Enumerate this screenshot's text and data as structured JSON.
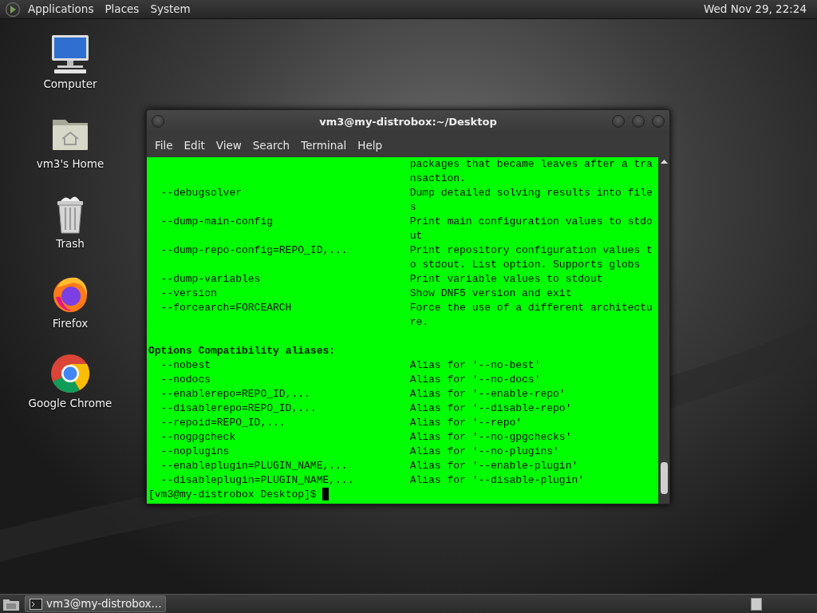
{
  "top_panel": {
    "menus": [
      "Applications",
      "Places",
      "System"
    ],
    "clock": "Wed Nov 29, 22:24"
  },
  "desktop_icons": [
    {
      "kind": "computer",
      "label": "Computer"
    },
    {
      "kind": "home",
      "label": "vm3's Home"
    },
    {
      "kind": "trash",
      "label": "Trash"
    },
    {
      "kind": "firefox",
      "label": "Firefox"
    },
    {
      "kind": "chrome",
      "label": "Google Chrome"
    }
  ],
  "terminal": {
    "title": "vm3@my-distrobox:~/Desktop",
    "menu": [
      "File",
      "Edit",
      "View",
      "Search",
      "Terminal",
      "Help"
    ],
    "lines": [
      {
        "kind": "row",
        "description": "packages that became leaves after a tra"
      },
      {
        "kind": "row",
        "description": "nsaction."
      },
      {
        "kind": "row",
        "option": "--debugsolver",
        "description": "Dump detailed solving results into file"
      },
      {
        "kind": "row",
        "description": "s"
      },
      {
        "kind": "row",
        "option": "--dump-main-config",
        "description": "Print main configuration values to stdo"
      },
      {
        "kind": "row",
        "description": "ut"
      },
      {
        "kind": "row",
        "option": "--dump-repo-config=REPO_ID,...",
        "description": "Print repository configuration values t"
      },
      {
        "kind": "row",
        "description": "o stdout. List option. Supports globs"
      },
      {
        "kind": "row",
        "option": "--dump-variables",
        "description": "Print variable values to stdout"
      },
      {
        "kind": "row",
        "option": "--version",
        "description": "Show DNF5 version and exit"
      },
      {
        "kind": "row",
        "option": "--forcearch=FORCEARCH",
        "description": "Force the use of a different architectu"
      },
      {
        "kind": "row",
        "description": "re."
      },
      {
        "kind": "blank"
      },
      {
        "kind": "heading",
        "text": "Options Compatibility aliases:"
      },
      {
        "kind": "row",
        "option": "--nobest",
        "description": "Alias for '--no-best'"
      },
      {
        "kind": "row",
        "option": "--nodocs",
        "description": "Alias for '--no-docs'"
      },
      {
        "kind": "row",
        "option": "--enablerepo=REPO_ID,...",
        "description": "Alias for '--enable-repo'"
      },
      {
        "kind": "row",
        "option": "--disablerepo=REPO_ID,...",
        "description": "Alias for '--disable-repo'"
      },
      {
        "kind": "row",
        "option": "--repoid=REPO_ID,...",
        "description": "Alias for '--repo'"
      },
      {
        "kind": "row",
        "option": "--nogpgcheck",
        "description": "Alias for '--no-gpgchecks'"
      },
      {
        "kind": "row",
        "option": "--noplugins",
        "description": "Alias for '--no-plugins'"
      },
      {
        "kind": "row",
        "option": "--enableplugin=PLUGIN_NAME,...",
        "description": "Alias for '--enable-plugin'"
      },
      {
        "kind": "row",
        "option": "--disableplugin=PLUGIN_NAME,...",
        "description": "Alias for '--disable-plugin'"
      },
      {
        "kind": "prompt",
        "text": "[vm3@my-distrobox Desktop]$ "
      }
    ]
  },
  "taskbar": {
    "tasks": [
      {
        "label": "vm3@my-distrobox...",
        "selected": true
      }
    ]
  }
}
